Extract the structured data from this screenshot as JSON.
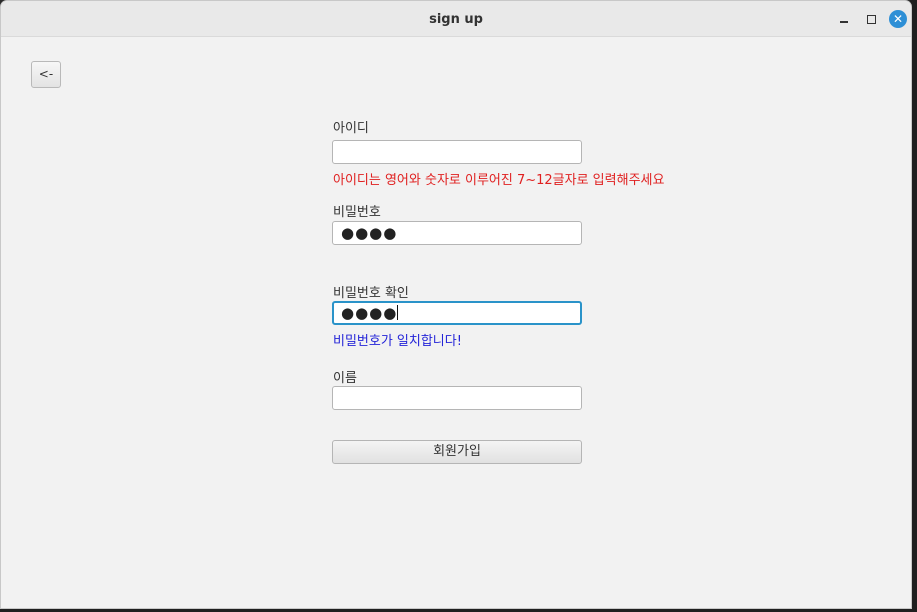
{
  "window": {
    "title": "sign up"
  },
  "titlebar": {
    "minimize_icon": "minimize-icon",
    "maximize_icon": "maximize-icon",
    "close_icon": "close-icon",
    "close_glyph": "✕",
    "accent": "#2e8fd6"
  },
  "back_button": {
    "label": "<-"
  },
  "form": {
    "id_label": "아이디",
    "id_value": "",
    "id_error": "아이디는 영어와 숫자로 이루어진 7~12글자로 입력해주세요",
    "password_label": "비밀번호",
    "password_value": "●●●●",
    "password_confirm_label": "비밀번호 확인",
    "password_confirm_value": "●●●●",
    "password_match_message": "비밀번호가 일치합니다!",
    "name_label": "이름",
    "name_value": "",
    "submit_label": "회원가입"
  },
  "colors": {
    "error": "#e02020",
    "success": "#2424d8",
    "focus": "#2a93c9"
  }
}
